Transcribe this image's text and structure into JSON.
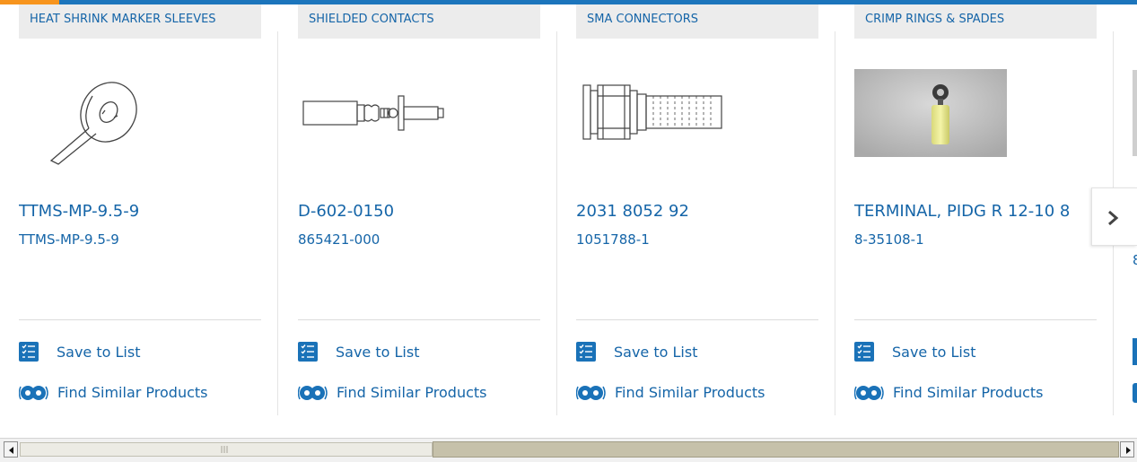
{
  "carousel": {
    "cards": [
      {
        "category": "HEAT SHRINK MARKER SLEEVES",
        "title": "TTMS-MP-9.5-9",
        "part_number": "TTMS-MP-9.5-9",
        "image_icon": "heat-shrink-roll-image",
        "save_label": "Save to List",
        "find_label": "Find Similar Products"
      },
      {
        "category": "SHIELDED CONTACTS",
        "title": "D-602-0150",
        "part_number": "865421-000",
        "image_icon": "shielded-contact-image",
        "save_label": "Save to List",
        "find_label": "Find Similar Products"
      },
      {
        "category": "SMA CONNECTORS",
        "title": "2031 8052 92",
        "part_number": "1051788-1",
        "image_icon": "sma-connector-image",
        "save_label": "Save to List",
        "find_label": "Find Similar Products"
      },
      {
        "category": "CRIMP RINGS & SPADES",
        "title": "TERMINAL, PIDG R 12-10 8",
        "part_number": "8-35108-1",
        "image_icon": "ring-terminal-photo",
        "save_label": "Save to List",
        "find_label": "Find Similar Products"
      }
    ],
    "partial_card": {
      "part_number_fragment": "8"
    },
    "next_icon": "chevron-right-icon"
  },
  "colors": {
    "brand_blue": "#1c75bc",
    "accent_orange": "#f7941d",
    "link_blue": "#1565a8",
    "category_bg": "#ececec"
  }
}
